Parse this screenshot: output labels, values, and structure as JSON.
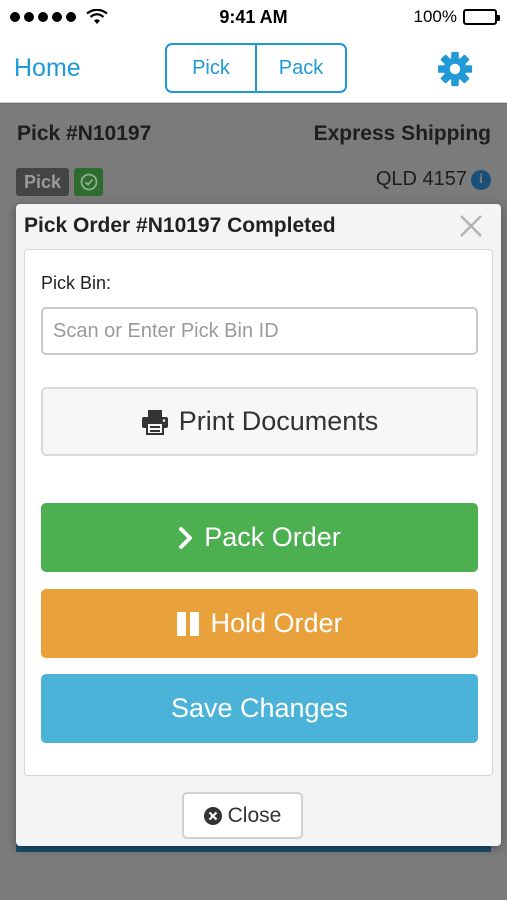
{
  "status_bar": {
    "time": "9:41 AM",
    "battery": "100%"
  },
  "nav": {
    "home": "Home",
    "segments": [
      "Pick",
      "Pack"
    ]
  },
  "background": {
    "order_title": "Pick #N10197",
    "shipping": "Express Shipping",
    "badge": "Pick",
    "location": "QLD 4157"
  },
  "modal": {
    "title": "Pick Order #N10197 Completed",
    "pick_bin_label": "Pick Bin:",
    "pick_bin_placeholder": "Scan or Enter Pick Bin ID",
    "print_label": "Print Documents",
    "pack_label": "Pack Order",
    "hold_label": "Hold Order",
    "save_label": "Save Changes",
    "close_label": "Close"
  },
  "colors": {
    "accent": "#1f9ad6",
    "pack": "#4caf50",
    "hold": "#e9a13b",
    "save": "#4bb3d8"
  }
}
